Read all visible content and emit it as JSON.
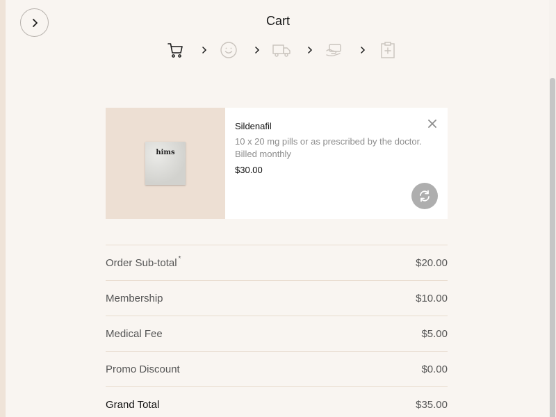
{
  "header": {
    "title": "Cart"
  },
  "steps": [
    {
      "icon": "cart-icon",
      "state": "active"
    },
    {
      "icon": "smiley-face-icon",
      "state": "inactive"
    },
    {
      "icon": "delivery-truck-icon",
      "state": "inactive"
    },
    {
      "icon": "payment-hand-icon",
      "state": "inactive"
    },
    {
      "icon": "medical-clipboard-icon",
      "state": "inactive"
    }
  ],
  "product": {
    "name": "Sildenafil",
    "description": "10 x 20 mg pills or as prescribed by the doctor. Billed monthly",
    "price": "$30.00",
    "brand_mark": "hims"
  },
  "summary": {
    "rows": [
      {
        "label": "Order Sub-total",
        "marker": "*",
        "value": "$20.00"
      },
      {
        "label": "Membership",
        "marker": "",
        "value": "$10.00"
      },
      {
        "label": "Medical Fee",
        "marker": "",
        "value": "$5.00"
      },
      {
        "label": "Promo Discount",
        "marker": "",
        "value": "$0.00"
      },
      {
        "label": "Grand Total",
        "marker": "",
        "value": "$35.00"
      }
    ]
  },
  "colors": {
    "background": "#f9f5f1",
    "accent_sand": "#eddfd3",
    "divider": "#e8dccf",
    "inactive_icon": "#c9c3bd",
    "active_icon": "#1a1a1a"
  }
}
